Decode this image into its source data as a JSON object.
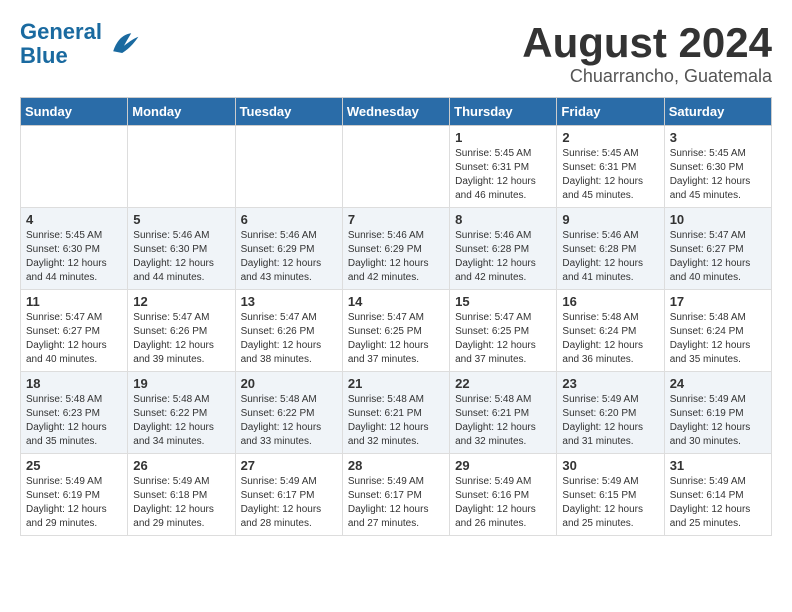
{
  "header": {
    "logo_line1": "General",
    "logo_line2": "Blue",
    "title": "August 2024",
    "subtitle": "Chuarrancho, Guatemala"
  },
  "weekdays": [
    "Sunday",
    "Monday",
    "Tuesday",
    "Wednesday",
    "Thursday",
    "Friday",
    "Saturday"
  ],
  "weeks": [
    [
      {
        "day": "",
        "info": ""
      },
      {
        "day": "",
        "info": ""
      },
      {
        "day": "",
        "info": ""
      },
      {
        "day": "",
        "info": ""
      },
      {
        "day": "1",
        "info": "Sunrise: 5:45 AM\nSunset: 6:31 PM\nDaylight: 12 hours\nand 46 minutes."
      },
      {
        "day": "2",
        "info": "Sunrise: 5:45 AM\nSunset: 6:31 PM\nDaylight: 12 hours\nand 45 minutes."
      },
      {
        "day": "3",
        "info": "Sunrise: 5:45 AM\nSunset: 6:30 PM\nDaylight: 12 hours\nand 45 minutes."
      }
    ],
    [
      {
        "day": "4",
        "info": "Sunrise: 5:45 AM\nSunset: 6:30 PM\nDaylight: 12 hours\nand 44 minutes."
      },
      {
        "day": "5",
        "info": "Sunrise: 5:46 AM\nSunset: 6:30 PM\nDaylight: 12 hours\nand 44 minutes."
      },
      {
        "day": "6",
        "info": "Sunrise: 5:46 AM\nSunset: 6:29 PM\nDaylight: 12 hours\nand 43 minutes."
      },
      {
        "day": "7",
        "info": "Sunrise: 5:46 AM\nSunset: 6:29 PM\nDaylight: 12 hours\nand 42 minutes."
      },
      {
        "day": "8",
        "info": "Sunrise: 5:46 AM\nSunset: 6:28 PM\nDaylight: 12 hours\nand 42 minutes."
      },
      {
        "day": "9",
        "info": "Sunrise: 5:46 AM\nSunset: 6:28 PM\nDaylight: 12 hours\nand 41 minutes."
      },
      {
        "day": "10",
        "info": "Sunrise: 5:47 AM\nSunset: 6:27 PM\nDaylight: 12 hours\nand 40 minutes."
      }
    ],
    [
      {
        "day": "11",
        "info": "Sunrise: 5:47 AM\nSunset: 6:27 PM\nDaylight: 12 hours\nand 40 minutes."
      },
      {
        "day": "12",
        "info": "Sunrise: 5:47 AM\nSunset: 6:26 PM\nDaylight: 12 hours\nand 39 minutes."
      },
      {
        "day": "13",
        "info": "Sunrise: 5:47 AM\nSunset: 6:26 PM\nDaylight: 12 hours\nand 38 minutes."
      },
      {
        "day": "14",
        "info": "Sunrise: 5:47 AM\nSunset: 6:25 PM\nDaylight: 12 hours\nand 37 minutes."
      },
      {
        "day": "15",
        "info": "Sunrise: 5:47 AM\nSunset: 6:25 PM\nDaylight: 12 hours\nand 37 minutes."
      },
      {
        "day": "16",
        "info": "Sunrise: 5:48 AM\nSunset: 6:24 PM\nDaylight: 12 hours\nand 36 minutes."
      },
      {
        "day": "17",
        "info": "Sunrise: 5:48 AM\nSunset: 6:24 PM\nDaylight: 12 hours\nand 35 minutes."
      }
    ],
    [
      {
        "day": "18",
        "info": "Sunrise: 5:48 AM\nSunset: 6:23 PM\nDaylight: 12 hours\nand 35 minutes."
      },
      {
        "day": "19",
        "info": "Sunrise: 5:48 AM\nSunset: 6:22 PM\nDaylight: 12 hours\nand 34 minutes."
      },
      {
        "day": "20",
        "info": "Sunrise: 5:48 AM\nSunset: 6:22 PM\nDaylight: 12 hours\nand 33 minutes."
      },
      {
        "day": "21",
        "info": "Sunrise: 5:48 AM\nSunset: 6:21 PM\nDaylight: 12 hours\nand 32 minutes."
      },
      {
        "day": "22",
        "info": "Sunrise: 5:48 AM\nSunset: 6:21 PM\nDaylight: 12 hours\nand 32 minutes."
      },
      {
        "day": "23",
        "info": "Sunrise: 5:49 AM\nSunset: 6:20 PM\nDaylight: 12 hours\nand 31 minutes."
      },
      {
        "day": "24",
        "info": "Sunrise: 5:49 AM\nSunset: 6:19 PM\nDaylight: 12 hours\nand 30 minutes."
      }
    ],
    [
      {
        "day": "25",
        "info": "Sunrise: 5:49 AM\nSunset: 6:19 PM\nDaylight: 12 hours\nand 29 minutes."
      },
      {
        "day": "26",
        "info": "Sunrise: 5:49 AM\nSunset: 6:18 PM\nDaylight: 12 hours\nand 29 minutes."
      },
      {
        "day": "27",
        "info": "Sunrise: 5:49 AM\nSunset: 6:17 PM\nDaylight: 12 hours\nand 28 minutes."
      },
      {
        "day": "28",
        "info": "Sunrise: 5:49 AM\nSunset: 6:17 PM\nDaylight: 12 hours\nand 27 minutes."
      },
      {
        "day": "29",
        "info": "Sunrise: 5:49 AM\nSunset: 6:16 PM\nDaylight: 12 hours\nand 26 minutes."
      },
      {
        "day": "30",
        "info": "Sunrise: 5:49 AM\nSunset: 6:15 PM\nDaylight: 12 hours\nand 25 minutes."
      },
      {
        "day": "31",
        "info": "Sunrise: 5:49 AM\nSunset: 6:14 PM\nDaylight: 12 hours\nand 25 minutes."
      }
    ]
  ]
}
